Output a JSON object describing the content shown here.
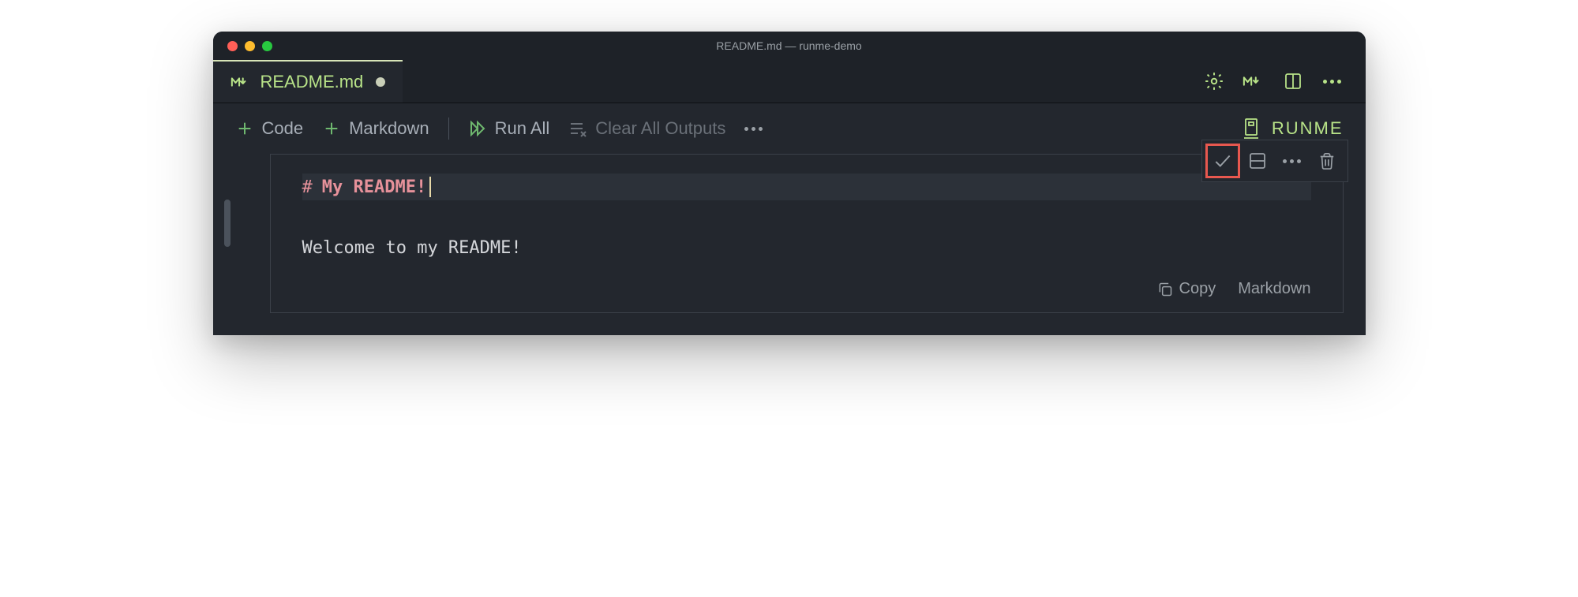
{
  "window": {
    "title": "README.md — runme-demo"
  },
  "tab": {
    "label": "README.md"
  },
  "toolbar": {
    "add_code": "Code",
    "add_markdown": "Markdown",
    "run_all": "Run All",
    "clear_outputs": "Clear All Outputs",
    "runme": "RUNME"
  },
  "cell": {
    "heading_marker": "#",
    "heading_text": "My README!",
    "body_text": "Welcome to my README!",
    "copy_label": "Copy",
    "lang_label": "Markdown"
  },
  "colors": {
    "accent_green": "#b8e388",
    "highlight_red": "#e8584f",
    "heading_pink": "#e6919a"
  }
}
